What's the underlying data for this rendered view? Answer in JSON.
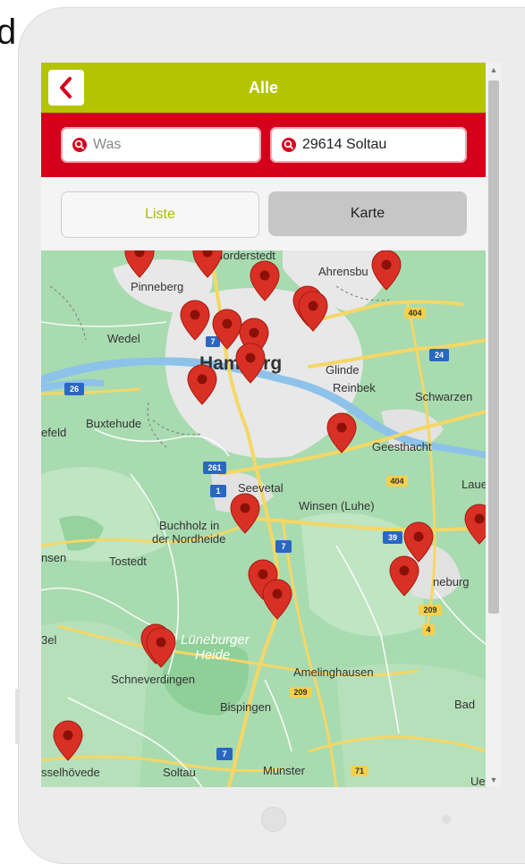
{
  "page": {
    "cut_text": "d"
  },
  "header": {
    "title": "Alle",
    "back_icon": "chevron-left-icon",
    "bar_color": "#b4c400"
  },
  "search": {
    "what_placeholder": "Was",
    "where_value": "29614 Soltau",
    "icon": "search-pin-icon",
    "bar_color": "#d5001c"
  },
  "tabs": [
    {
      "label": "Liste",
      "active": false
    },
    {
      "label": "Karte",
      "active": true
    }
  ],
  "map": {
    "places": {
      "norderstedt": "Norderstedt",
      "ahrensburg": "Ahrensbu",
      "pinneberg": "Pinneberg",
      "wedel": "Wedel",
      "hamburg": "Hamburg",
      "glinde": "Glinde",
      "reinbek": "Reinbek",
      "schwarzenbek": "Schwarzen",
      "buxtehude": "Buxtehude",
      "stade": "efeld",
      "geesthacht": "Geesthacht",
      "lauenburg": "Lauen",
      "seevetal": "Seevetal",
      "winsen": "Winsen (Luhe)",
      "buchholz1": "Buchholz in",
      "buchholz2": "der Nordheide",
      "tostedt": "Tostedt",
      "sen": "nsen",
      "lueneburg": "neburg",
      "bel": "3el",
      "heide1": "Lüneburger",
      "heide2": "Heide",
      "schneverdingen": "Schneverdingen",
      "amelinghausen": "Amelinghausen",
      "bispingen": "Bispingen",
      "bad": "Bad",
      "visselhoevede": "sselhövede",
      "soltau": "Soltau",
      "munster": "Munster",
      "ue": "Ue"
    },
    "shields": {
      "a7": "7",
      "a404_top": "404",
      "a24": "24",
      "a26": "26",
      "a261": "261",
      "a1": "1",
      "a404_mid": "404",
      "a39": "39",
      "a7_mid": "7",
      "b209": "209",
      "b4": "4",
      "b209_low": "209",
      "a7_low": "7",
      "b71": "71"
    },
    "pin_color": "#d93025",
    "land_color": "#a8dbb0",
    "city_color": "#e8e8e8",
    "water_color": "#8dc2ea"
  },
  "scrollbar": {
    "up_icon": "▲",
    "down_icon": "▼"
  }
}
